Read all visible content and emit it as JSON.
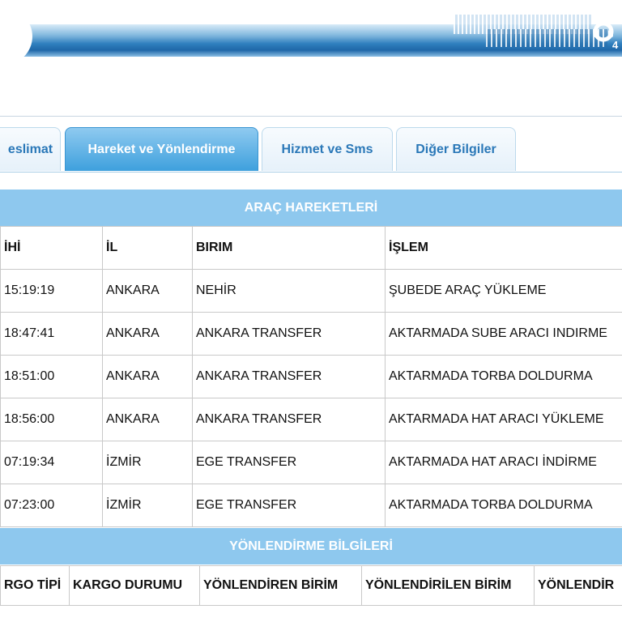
{
  "header": {
    "support_digit": "4"
  },
  "tabs": [
    {
      "label": "eslimat",
      "active": false
    },
    {
      "label": "Hareket ve Yönlendirme",
      "active": true
    },
    {
      "label": "Hizmet ve Sms",
      "active": false
    },
    {
      "label": "Diğer Bilgiler",
      "active": false
    }
  ],
  "vehicle_moves": {
    "title": "ARAÇ HAREKETLERİ",
    "columns": [
      "İHİ",
      "İL",
      "BIRIM",
      "İŞLEM"
    ],
    "rows": [
      {
        "time": "15:19:19",
        "city": "ANKARA",
        "unit": "NEHİR",
        "operation": "ŞUBEDE ARAÇ YÜKLEME"
      },
      {
        "time": "18:47:41",
        "city": "ANKARA",
        "unit": "ANKARA TRANSFER",
        "operation": "AKTARMADA SUBE ARACI INDIRME"
      },
      {
        "time": "18:51:00",
        "city": "ANKARA",
        "unit": "ANKARA TRANSFER",
        "operation": "AKTARMADA TORBA DOLDURMA"
      },
      {
        "time": "18:56:00",
        "city": "ANKARA",
        "unit": "ANKARA TRANSFER",
        "operation": "AKTARMADA HAT ARACI YÜKLEME"
      },
      {
        "time": "07:19:34",
        "city": "İZMİR",
        "unit": "EGE TRANSFER",
        "operation": "AKTARMADA HAT ARACI İNDİRME"
      },
      {
        "time": "07:23:00",
        "city": "İZMİR",
        "unit": "EGE TRANSFER",
        "operation": "AKTARMADA TORBA DOLDURMA"
      }
    ]
  },
  "redirection": {
    "title": "YÖNLENDİRME BİLGİLERİ",
    "columns": [
      "RGO TİPİ",
      "KARGO DURUMU",
      "YÖNLENDİREN BİRİM",
      "YÖNLENDİRİLEN BİRİM",
      "YÖNLENDİR"
    ]
  },
  "colors": {
    "accent": "#8ec8ee",
    "active_tab": "#3ea0dd",
    "tab_text": "#2a78b8"
  }
}
